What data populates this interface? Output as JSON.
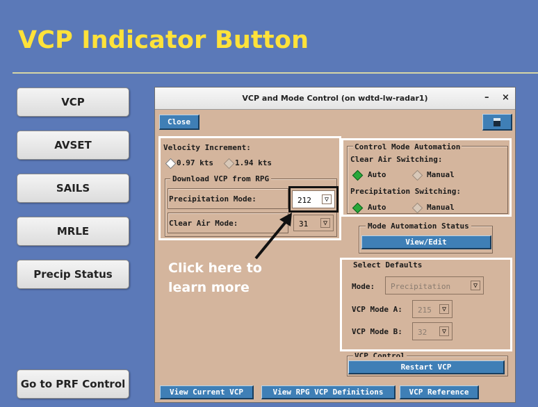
{
  "slide": {
    "title": "VCP Indicator Button",
    "callout_line1": "Click here to",
    "callout_line2": "learn more"
  },
  "nav": [
    {
      "label": "VCP"
    },
    {
      "label": "AVSET"
    },
    {
      "label": "SAILS"
    },
    {
      "label": "MRLE"
    },
    {
      "label": "Precip Status"
    },
    {
      "label": "Go to PRF Control"
    }
  ],
  "dialog": {
    "title": "VCP and Mode Control (on wdtd-lw-radar1)",
    "minimize": "–",
    "close_x": "×",
    "close_label": "Close",
    "velocity_increment_label": "Velocity Increment:",
    "velocity_opt1": "0.97 kts",
    "velocity_opt2": "1.94 kts",
    "download_group": "Download VCP from RPG",
    "precip_mode_label": "Precipitation Mode:",
    "precip_mode_value": "212",
    "clear_air_label": "Clear Air Mode:",
    "clear_air_value": "31",
    "control_mode_group": "Control Mode Automation",
    "clear_air_switching": "Clear Air Switching:",
    "precip_switching": "Precipitation Switching:",
    "auto": "Auto",
    "manual": "Manual",
    "mode_automation_status": "Mode Automation Status",
    "view_edit": "View/Edit",
    "select_defaults": "Select Defaults",
    "mode_label": "Mode:",
    "mode_value": "Precipitation",
    "vcp_mode_a_label": "VCP Mode A:",
    "vcp_mode_a_value": "215",
    "vcp_mode_b_label": "VCP Mode B:",
    "vcp_mode_b_value": "32",
    "vcp_control": "VCP Control",
    "restart_vcp": "Restart VCP",
    "view_current_vcp": "View Current VCP",
    "view_rpg_defs": "View RPG VCP Definitions",
    "vcp_reference": "VCP Reference",
    "dropdown_arrow": "▽"
  },
  "colors": {
    "background": "#5b79b8",
    "title": "#ffe23a",
    "dialog_bg": "#d4b59d",
    "button_blue": "#3f7fb6",
    "radio_on": "#28a83a"
  }
}
